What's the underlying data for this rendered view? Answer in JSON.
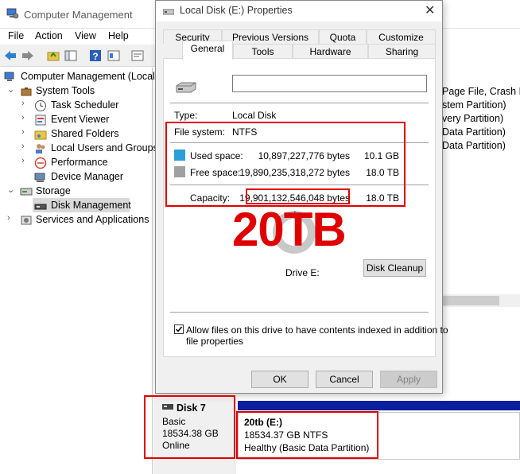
{
  "cm": {
    "title": "Computer Management",
    "menu": [
      "File",
      "Action",
      "View",
      "Help"
    ],
    "tree": {
      "root": "Computer Management (Local",
      "system_tools": "System Tools",
      "task_scheduler": "Task Scheduler",
      "event_viewer": "Event Viewer",
      "shared_folders": "Shared Folders",
      "local_users": "Local Users and Groups",
      "performance": "Performance",
      "device_manager": "Device Manager",
      "storage": "Storage",
      "disk_management": "Disk Management",
      "services": "Services and Applications"
    },
    "right_volumes": [
      "Page File, Crash D",
      "stem Partition)",
      "very Partition)",
      "Data Partition)",
      "Data Partition)"
    ]
  },
  "disk": {
    "name": "Disk 7",
    "type": "Basic",
    "size": "18534.38 GB",
    "status": "Online",
    "partition_title": "20tb  (E:)",
    "partition_size": "18534.37 GB NTFS",
    "partition_status": "Healthy (Basic Data Partition)"
  },
  "dialog": {
    "title": "Local Disk (E:) Properties",
    "tabs_row1": [
      "Security",
      "Previous Versions",
      "Quota",
      "Customize"
    ],
    "tabs_row2": [
      "General",
      "Tools",
      "Hardware",
      "Sharing"
    ],
    "name_value": "",
    "type_label": "Type:",
    "type_value": "Local Disk",
    "fs_label": "File system:",
    "fs_value": "NTFS",
    "used_label": "Used space:",
    "used_bytes": "10,897,227,776 bytes",
    "used_size": "10.1 GB",
    "free_label": "Free space:",
    "free_bytes": "19,890,235,318,272 bytes",
    "free_size": "18.0 TB",
    "capacity_label": "Capacity:",
    "capacity_bytes": "19,901,132,546,048 bytes",
    "capacity_size": "18.0 TB",
    "drive_label": "Drive E:",
    "cleanup_button": "Disk Cleanup",
    "index_text_1": "Allow files on this drive to have contents indexed in addition to",
    "index_text_2": "file properties",
    "ok": "OK",
    "cancel": "Cancel",
    "apply": "Apply"
  },
  "annotation": {
    "big_text": "20TB"
  },
  "colors": {
    "used": "#2d9fd8",
    "free": "#a0a0a0",
    "annotation": "#e00000",
    "disk_bar": "#0a1f9e"
  }
}
